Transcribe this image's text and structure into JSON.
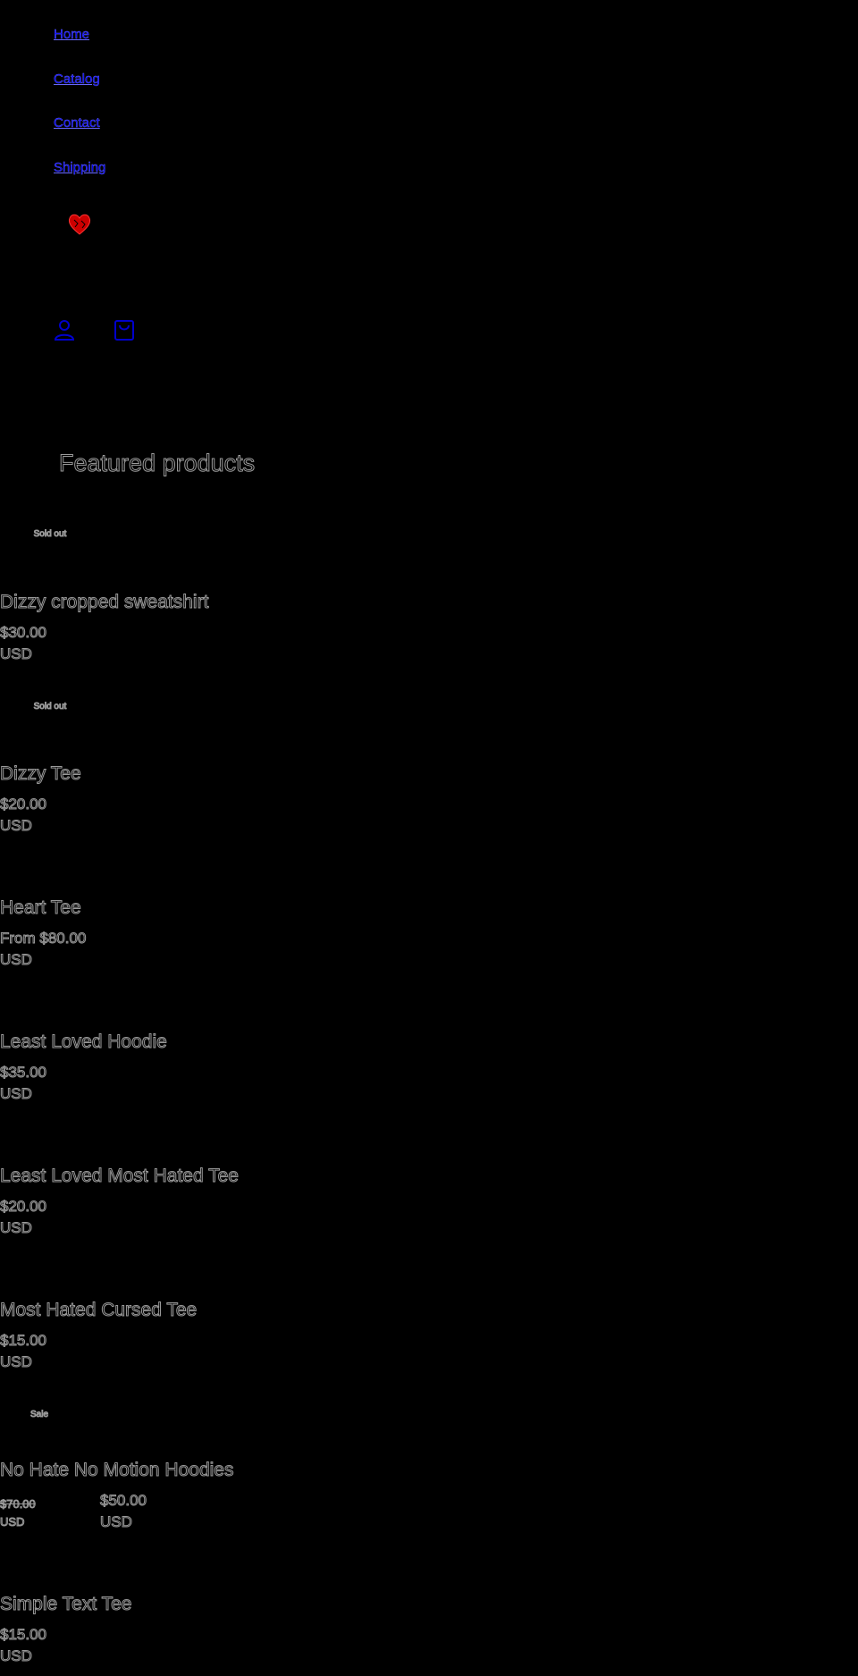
{
  "nav": {
    "home": "Home",
    "catalog": "Catalog",
    "contact": "Contact",
    "shipping": "Shipping"
  },
  "colors": {
    "link": "#0000ee",
    "logo": "#cc0000",
    "icon": "#0000cc",
    "background": "#000000"
  },
  "header": {
    "logo_icon": "heart-icon",
    "account_icon": "user-icon",
    "cart_icon": "bag-icon"
  },
  "featured": {
    "title": "Featured products",
    "products": [
      {
        "badge": "Sold out",
        "title": "Dizzy cropped sweatshirt",
        "price": "$30.00",
        "currency": "USD"
      },
      {
        "badge": "Sold out",
        "title": "Dizzy Tee",
        "price": "$20.00",
        "currency": "USD"
      },
      {
        "title": "Heart Tee",
        "price": "From $80.00",
        "currency": "USD"
      },
      {
        "title": "Least Loved Hoodie",
        "price": "$35.00",
        "currency": "USD"
      },
      {
        "title": "Least Loved Most Hated Tee",
        "price": "$20.00",
        "currency": "USD"
      },
      {
        "title": "Most Hated Cursed Tee",
        "price": "$15.00",
        "currency": "USD"
      },
      {
        "badge": "Sale",
        "title": "No Hate No Motion Hoodies",
        "compare_price": "$70.00",
        "compare_currency": "USD",
        "price": "$50.00",
        "currency": "USD"
      },
      {
        "title": "Simple Text Tee",
        "price": "$15.00",
        "currency": "USD"
      }
    ]
  }
}
